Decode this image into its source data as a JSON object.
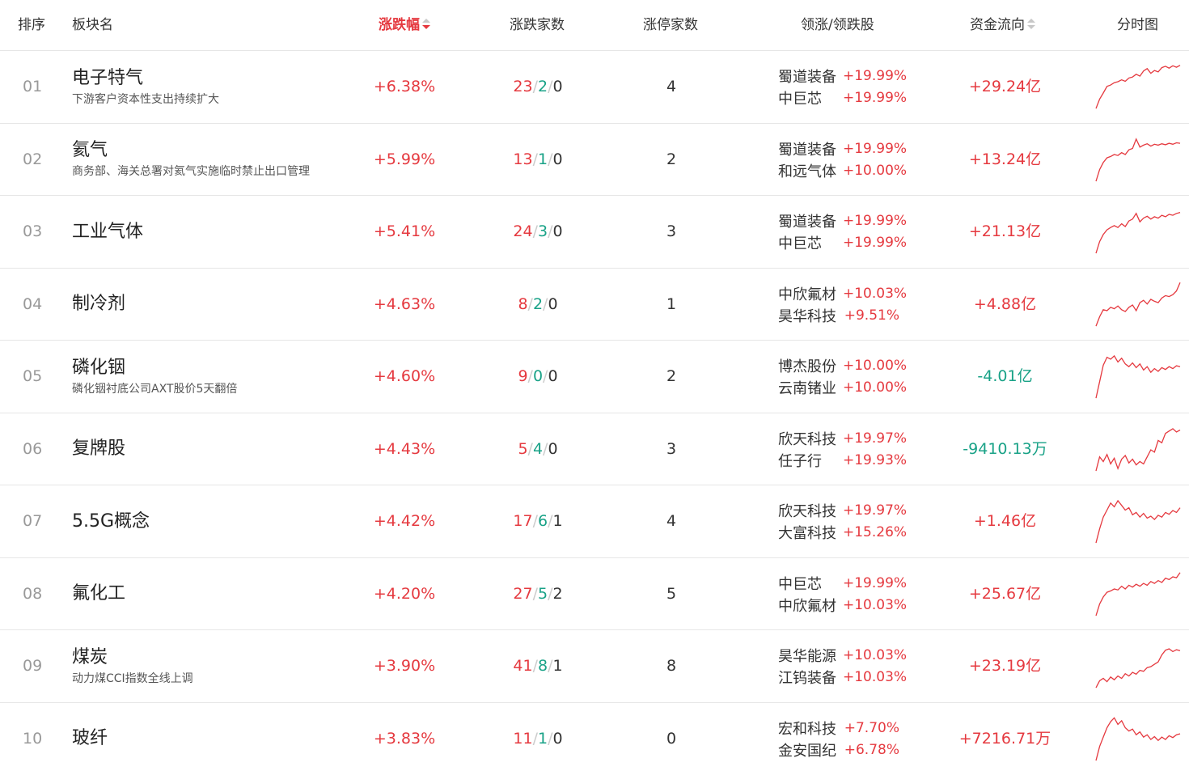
{
  "headers": {
    "rank": "排序",
    "name": "板块名",
    "change": "涨跌幅",
    "counts": "涨跌家数",
    "limit_up": "涨停家数",
    "leaders": "领涨/领跌股",
    "flow": "资金流向",
    "chart": "分时图"
  },
  "colors": {
    "up": "#e5393f",
    "down": "#19a287",
    "neutral": "#333333"
  },
  "rows": [
    {
      "rank": "01",
      "name": "电子特气",
      "sub": "下游客户资本性支出持续扩大",
      "change": "+6.38%",
      "up": "23",
      "down": "2",
      "flat": "0",
      "limit": "4",
      "l1_name": "蜀道装备",
      "l1_pct": "+19.99%",
      "l2_name": "中巨芯",
      "l2_pct": "+19.99%",
      "flow": "+29.24亿",
      "flow_dir": "pos",
      "spark": [
        0.05,
        0.25,
        0.38,
        0.52,
        0.55,
        0.6,
        0.62,
        0.66,
        0.63,
        0.7,
        0.72,
        0.78,
        0.74,
        0.85,
        0.9,
        0.8,
        0.86,
        0.83,
        0.92,
        0.95,
        0.91,
        0.96,
        0.93,
        0.97
      ]
    },
    {
      "rank": "02",
      "name": "氦气",
      "sub": "商务部、海关总署对氦气实施临时禁止出口管理",
      "change": "+5.99%",
      "up": "13",
      "down": "1",
      "flat": "0",
      "limit": "2",
      "l1_name": "蜀道装备",
      "l1_pct": "+19.99%",
      "l2_name": "和远气体",
      "l2_pct": "+10.00%",
      "flow": "+13.24亿",
      "flow_dir": "pos",
      "spark": [
        0.05,
        0.3,
        0.45,
        0.55,
        0.58,
        0.62,
        0.6,
        0.66,
        0.62,
        0.72,
        0.75,
        0.95,
        0.78,
        0.82,
        0.85,
        0.8,
        0.84,
        0.82,
        0.85,
        0.83,
        0.86,
        0.84,
        0.87,
        0.86
      ]
    },
    {
      "rank": "03",
      "name": "工业气体",
      "sub": "",
      "change": "+5.41%",
      "up": "24",
      "down": "3",
      "flat": "0",
      "limit": "3",
      "l1_name": "蜀道装备",
      "l1_pct": "+19.99%",
      "l2_name": "中巨芯",
      "l2_pct": "+19.99%",
      "flow": "+21.13亿",
      "flow_dir": "pos",
      "spark": [
        0.05,
        0.3,
        0.45,
        0.55,
        0.6,
        0.64,
        0.6,
        0.68,
        0.62,
        0.74,
        0.78,
        0.9,
        0.72,
        0.8,
        0.84,
        0.78,
        0.83,
        0.8,
        0.86,
        0.83,
        0.88,
        0.86,
        0.9,
        0.92
      ]
    },
    {
      "rank": "04",
      "name": "制冷剂",
      "sub": "",
      "change": "+4.63%",
      "up": "8",
      "down": "2",
      "flat": "0",
      "limit": "1",
      "l1_name": "中欣氟材",
      "l1_pct": "+10.03%",
      "l2_name": "昊华科技",
      "l2_pct": "+9.51%",
      "flow": "+4.88亿",
      "flow_dir": "pos",
      "spark": [
        0.05,
        0.25,
        0.4,
        0.38,
        0.45,
        0.42,
        0.48,
        0.4,
        0.36,
        0.45,
        0.5,
        0.38,
        0.55,
        0.6,
        0.52,
        0.62,
        0.58,
        0.55,
        0.65,
        0.7,
        0.68,
        0.72,
        0.8,
        0.98
      ]
    },
    {
      "rank": "05",
      "name": "磷化铟",
      "sub": "磷化铟衬底公司AXT股价5天翻倍",
      "change": "+4.60%",
      "up": "9",
      "down": "0",
      "flat": "0",
      "limit": "2",
      "l1_name": "博杰股份",
      "l1_pct": "+10.00%",
      "l2_name": "云南锗业",
      "l2_pct": "+10.00%",
      "flow": "-4.01亿",
      "flow_dir": "neg",
      "spark": [
        0.05,
        0.4,
        0.75,
        0.92,
        0.88,
        0.95,
        0.82,
        0.9,
        0.78,
        0.72,
        0.8,
        0.7,
        0.78,
        0.65,
        0.72,
        0.6,
        0.68,
        0.62,
        0.7,
        0.66,
        0.72,
        0.68,
        0.74,
        0.72
      ]
    },
    {
      "rank": "06",
      "name": "复牌股",
      "sub": "",
      "change": "+4.43%",
      "up": "5",
      "down": "4",
      "flat": "0",
      "limit": "3",
      "l1_name": "欣天科技",
      "l1_pct": "+19.97%",
      "l2_name": "任子行",
      "l2_pct": "+19.93%",
      "flow": "-9410.13万",
      "flow_dir": "neg",
      "spark": [
        0.05,
        0.35,
        0.25,
        0.4,
        0.2,
        0.32,
        0.1,
        0.3,
        0.38,
        0.22,
        0.3,
        0.18,
        0.25,
        0.2,
        0.35,
        0.5,
        0.45,
        0.7,
        0.65,
        0.85,
        0.9,
        0.95,
        0.88,
        0.92
      ]
    },
    {
      "rank": "07",
      "name": "5.5G概念",
      "sub": "",
      "change": "+4.42%",
      "up": "17",
      "down": "6",
      "flat": "1",
      "limit": "4",
      "l1_name": "欣天科技",
      "l1_pct": "+19.97%",
      "l2_name": "大富科技",
      "l2_pct": "+15.26%",
      "flow": "+1.46亿",
      "flow_dir": "pos",
      "spark": [
        0.05,
        0.35,
        0.6,
        0.75,
        0.9,
        0.82,
        0.95,
        0.85,
        0.75,
        0.8,
        0.65,
        0.7,
        0.6,
        0.68,
        0.58,
        0.62,
        0.55,
        0.64,
        0.6,
        0.7,
        0.66,
        0.74,
        0.7,
        0.8
      ]
    },
    {
      "rank": "08",
      "name": "氟化工",
      "sub": "",
      "change": "+4.20%",
      "up": "27",
      "down": "5",
      "flat": "2",
      "limit": "5",
      "l1_name": "中巨芯",
      "l1_pct": "+19.99%",
      "l2_name": "中欣氟材",
      "l2_pct": "+10.03%",
      "flow": "+25.67亿",
      "flow_dir": "pos",
      "spark": [
        0.05,
        0.3,
        0.45,
        0.55,
        0.58,
        0.62,
        0.6,
        0.68,
        0.62,
        0.7,
        0.66,
        0.72,
        0.68,
        0.74,
        0.7,
        0.78,
        0.74,
        0.8,
        0.76,
        0.85,
        0.82,
        0.88,
        0.86,
        0.97
      ]
    },
    {
      "rank": "09",
      "name": "煤炭",
      "sub": "动力煤CCI指数全线上调",
      "change": "+3.90%",
      "up": "41",
      "down": "8",
      "flat": "1",
      "limit": "8",
      "l1_name": "昊华能源",
      "l1_pct": "+10.03%",
      "l2_name": "江钨装备",
      "l2_pct": "+10.03%",
      "flow": "+23.19亿",
      "flow_dir": "pos",
      "spark": [
        0.05,
        0.2,
        0.25,
        0.18,
        0.28,
        0.22,
        0.3,
        0.25,
        0.35,
        0.3,
        0.38,
        0.34,
        0.42,
        0.4,
        0.48,
        0.5,
        0.55,
        0.6,
        0.75,
        0.85,
        0.88,
        0.82,
        0.86,
        0.84
      ]
    },
    {
      "rank": "10",
      "name": "玻纤",
      "sub": "",
      "change": "+3.83%",
      "up": "11",
      "down": "1",
      "flat": "0",
      "limit": "0",
      "l1_name": "宏和科技",
      "l1_pct": "+7.70%",
      "l2_name": "金安国纪",
      "l2_pct": "+6.78%",
      "flow": "+7216.71万",
      "flow_dir": "pos",
      "spark": [
        0.05,
        0.35,
        0.55,
        0.75,
        0.88,
        0.96,
        0.82,
        0.9,
        0.75,
        0.68,
        0.72,
        0.6,
        0.66,
        0.55,
        0.6,
        0.5,
        0.56,
        0.48,
        0.55,
        0.5,
        0.58,
        0.54,
        0.6,
        0.62
      ]
    }
  ]
}
